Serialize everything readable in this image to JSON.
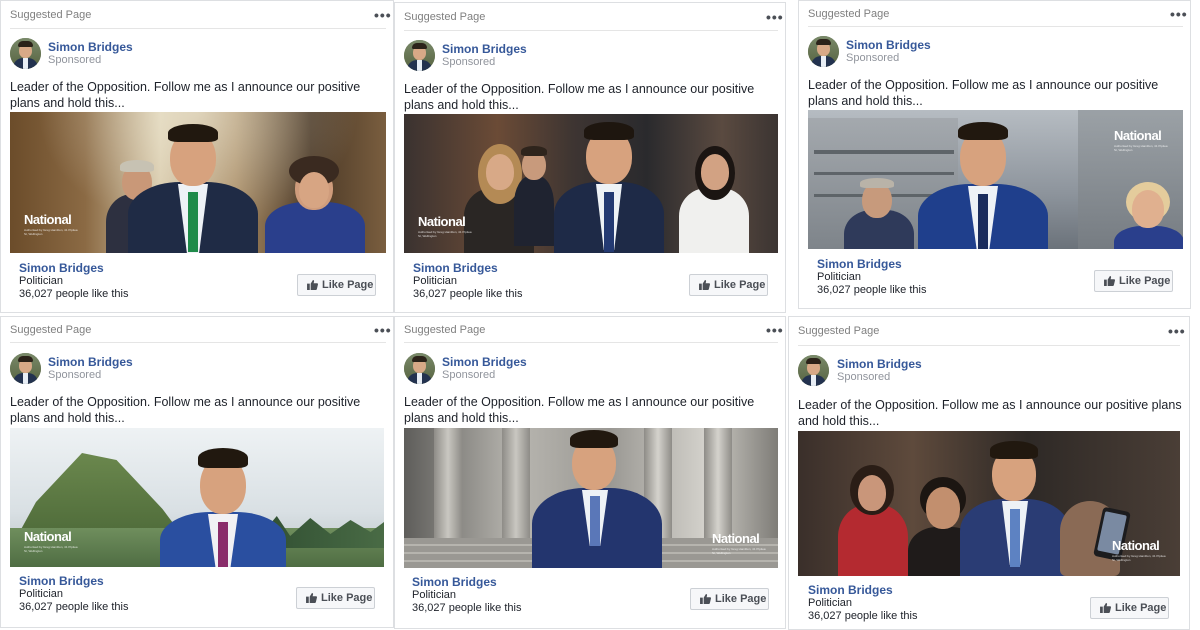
{
  "cards": [
    {
      "top_label": "Suggested Page",
      "more_label": "•••",
      "page_name": "Simon Bridges",
      "sponsored": "Sponsored",
      "body": "Leader of the Opposition. Follow me as I announce our positive plans and hold this...",
      "logo_text": "National",
      "footer_name": "Simon Bridges",
      "category": "Politician",
      "likes": "36,027 people like this",
      "like_button": "Like Page",
      "photo_scene": "hallway-group"
    },
    {
      "top_label": "Suggested Page",
      "more_label": "•••",
      "page_name": "Simon Bridges",
      "sponsored": "Sponsored",
      "body": "Leader of the Opposition. Follow me as I announce our positive plans and hold this...",
      "logo_text": "National",
      "footer_name": "Simon Bridges",
      "category": "Politician",
      "likes": "36,027 people like this",
      "like_button": "Like Page",
      "photo_scene": "walking-group"
    },
    {
      "top_label": "Suggested Page",
      "more_label": "•••",
      "page_name": "Simon Bridges",
      "sponsored": "Sponsored",
      "body": "Leader of the Opposition. Follow me as I announce our positive plans and hold this...",
      "logo_text": "National",
      "footer_name": "Simon Bridges",
      "category": "Politician",
      "likes": "36,027 people like this",
      "like_button": "Like Page",
      "photo_scene": "parliament-beehive"
    },
    {
      "top_label": "Suggested Page",
      "more_label": "•••",
      "page_name": "Simon Bridges",
      "sponsored": "Sponsored",
      "body": "Leader of the Opposition. Follow me as I announce our positive plans and hold this...",
      "logo_text": "National",
      "footer_name": "Simon Bridges",
      "category": "Politician",
      "likes": "36,027 people like this",
      "like_button": "Like Page",
      "photo_scene": "mountain-portrait"
    },
    {
      "top_label": "Suggested Page",
      "more_label": "•••",
      "page_name": "Simon Bridges",
      "sponsored": "Sponsored",
      "body": "Leader of the Opposition. Follow me as I announce our positive plans and hold this...",
      "logo_text": "National",
      "footer_name": "Simon Bridges",
      "category": "Politician",
      "likes": "36,027 people like this",
      "like_button": "Like Page",
      "photo_scene": "seated-steps"
    },
    {
      "top_label": "Suggested Page",
      "more_label": "•••",
      "page_name": "Simon Bridges",
      "sponsored": "Sponsored",
      "body": "Leader of the Opposition. Follow me as I announce our positive plans and hold this...",
      "logo_text": "National",
      "footer_name": "Simon Bridges",
      "category": "Politician",
      "likes": "36,027 people like this",
      "like_button": "Like Page",
      "photo_scene": "crowd-selfie"
    }
  ],
  "colors": {
    "link": "#365899",
    "meta_text": "#90949c",
    "border": "#dddfe2",
    "button_bg": "#f6f7f9"
  }
}
